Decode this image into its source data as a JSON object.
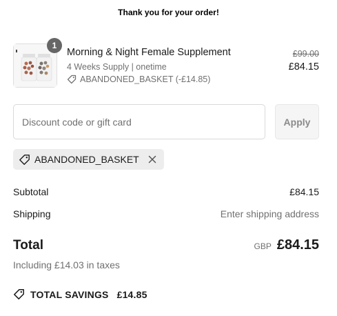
{
  "banner": {
    "text": "Thank you for your order!"
  },
  "line_item": {
    "quantity": "1",
    "name": "Morning & Night Female Supplement",
    "variant": "4 Weeks Supply | onetime",
    "discount_label": "ABANDONED_BASKET (-£14.85)",
    "original_price": "£99.00",
    "price": "£84.15",
    "thumbnail_icon": "supplement-bottles-image"
  },
  "discount": {
    "placeholder": "Discount code or gift card",
    "value": "",
    "apply_label": "Apply"
  },
  "applied_code": {
    "label": "ABANDONED_BASKET"
  },
  "summary": {
    "subtotal_label": "Subtotal",
    "subtotal_value": "£84.15",
    "shipping_label": "Shipping",
    "shipping_value": "Enter shipping address",
    "total_label": "Total",
    "currency": "GBP",
    "total_value": "£84.15",
    "taxes_note": "Including £14.03 in taxes"
  },
  "savings": {
    "label": "TOTAL SAVINGS",
    "amount": "£14.85"
  },
  "colors": {
    "text": "#1a1a1a",
    "muted": "#707070",
    "chip_bg": "#ededed",
    "badge_bg": "#666666"
  }
}
